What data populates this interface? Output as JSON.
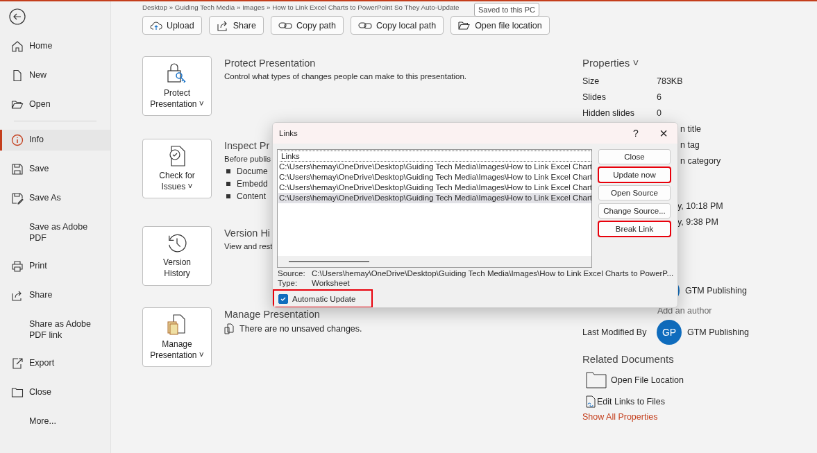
{
  "breadcrumb": "Desktop » Guiding Tech Media » Images » How to Link Excel Charts to PowerPoint So They Auto-Update",
  "sidebar": {
    "items": [
      {
        "label": "Home",
        "selected": false
      },
      {
        "label": "New",
        "selected": false
      },
      {
        "label": "Open",
        "selected": false
      },
      {
        "label": "Info",
        "selected": true
      },
      {
        "label": "Save",
        "selected": false
      },
      {
        "label": "Save As",
        "selected": false
      },
      {
        "label": "Save as Adobe PDF",
        "selected": false
      },
      {
        "label": "Print",
        "selected": false
      },
      {
        "label": "Share",
        "selected": false
      },
      {
        "label": "Share as Adobe PDF link",
        "selected": false
      },
      {
        "label": "Export",
        "selected": false
      },
      {
        "label": "Close",
        "selected": false
      },
      {
        "label": "More...",
        "selected": false
      }
    ]
  },
  "toolbar": [
    {
      "label": "Upload"
    },
    {
      "label": "Share"
    },
    {
      "label": "Copy path"
    },
    {
      "label": "Copy local path"
    },
    {
      "label": "Open file location"
    }
  ],
  "tooltip": "Saved to this PC",
  "sections": [
    {
      "tile": [
        "Protect",
        "Presentation ˅"
      ],
      "title": "Protect Presentation",
      "text": "Control what types of changes people can make to this presentation."
    },
    {
      "tile": [
        "Check for",
        "Issues ˅"
      ],
      "title": "Inspect Pr",
      "text": "Before publis",
      "bullets": [
        "Docume",
        "Embedd",
        "Content"
      ]
    },
    {
      "tile": [
        "Version",
        "History"
      ],
      "title": "Version Hi",
      "text": "View and rest"
    },
    {
      "tile": [
        "Manage",
        "Presentation ˅"
      ],
      "title": "Manage Presentation",
      "status": "There are no unsaved changes."
    }
  ],
  "properties": {
    "title": "Properties ˅",
    "rows": [
      {
        "label": "Size",
        "value": "783KB"
      },
      {
        "label": "Slides",
        "value": "6"
      },
      {
        "label": "Hidden slides",
        "value": "0"
      }
    ],
    "partial": [
      "n title",
      "n tag",
      "n category"
    ],
    "dates": [
      "y, 10:18 PM",
      "y, 9:38 PM"
    ],
    "author": {
      "name": "GTM Publishing"
    },
    "add_author": "Add an author",
    "last_modified": {
      "label": "Last Modified By",
      "initials": "GP",
      "name": "GTM Publishing"
    },
    "related_title": "Related Documents",
    "related": [
      "Open File Location",
      "Edit Links to Files"
    ],
    "show_all": "Show All Properties"
  },
  "dialog": {
    "title": "Links",
    "help": "?",
    "close": "×",
    "list_header": "Links",
    "links": [
      {
        "path": "C:\\Users\\hemay\\OneDrive\\Desktop\\Guiding Tech Media\\Images\\How to Link Excel Chart",
        "selected": false
      },
      {
        "path": "C:\\Users\\hemay\\OneDrive\\Desktop\\Guiding Tech Media\\Images\\How to Link Excel Chart",
        "selected": false
      },
      {
        "path": "C:\\Users\\hemay\\OneDrive\\Desktop\\Guiding Tech Media\\Images\\How to Link Excel Chart",
        "selected": false
      },
      {
        "path": "C:\\Users\\hemay\\OneDrive\\Desktop\\Guiding Tech Media\\Images\\How to Link Excel Chart",
        "selected": true
      }
    ],
    "buttons": [
      {
        "label": "Close",
        "highlighted": false
      },
      {
        "label": "Update now",
        "highlighted": true
      },
      {
        "label": "Open Source",
        "highlighted": false
      },
      {
        "label": "Change Source...",
        "highlighted": false
      },
      {
        "label": "Break Link",
        "highlighted": true
      }
    ],
    "source_label": "Source:",
    "source": "C:\\Users\\hemay\\OneDrive\\Desktop\\Guiding Tech Media\\Images\\How to Link Excel Charts to PowerP...",
    "type_label": "Type:",
    "type": "Worksheet",
    "auto_update": {
      "label": "Automatic Update",
      "checked": true,
      "highlighted": true
    }
  }
}
